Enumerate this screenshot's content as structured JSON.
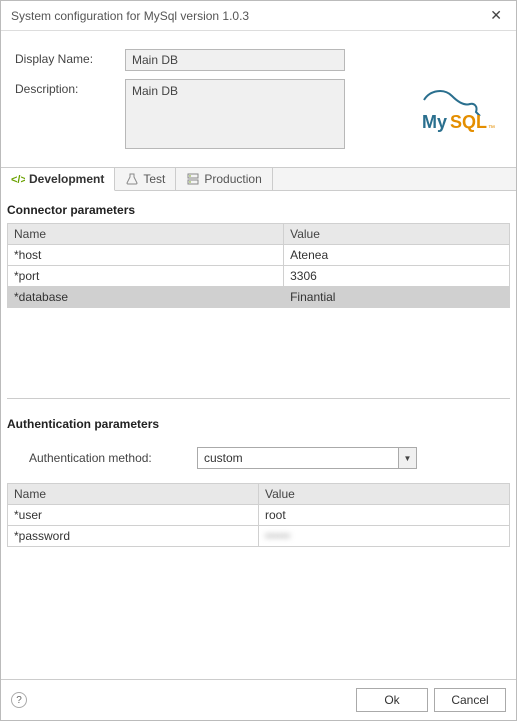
{
  "window": {
    "title": "System configuration for MySql version 1.0.3"
  },
  "header": {
    "display_name_label": "Display Name:",
    "display_name_value": "Main DB",
    "description_label": "Description:",
    "description_value": "Main DB",
    "logo_text_top": "My",
    "logo_text_bottom": "SQL"
  },
  "tabs": {
    "development": "Development",
    "test": "Test",
    "production": "Production"
  },
  "connector": {
    "title": "Connector parameters",
    "col_name": "Name",
    "col_value": "Value",
    "rows": [
      {
        "name": "*host",
        "value": "Atenea"
      },
      {
        "name": "*port",
        "value": "3306"
      },
      {
        "name": "*database",
        "value": "Finantial"
      }
    ]
  },
  "auth": {
    "title": "Authentication parameters",
    "method_label": "Authentication method:",
    "method_value": "custom",
    "col_name": "Name",
    "col_value": "Value",
    "rows": [
      {
        "name": "*user",
        "value": "root"
      },
      {
        "name": "*password",
        "value": "••••••"
      }
    ]
  },
  "footer": {
    "ok": "Ok",
    "cancel": "Cancel"
  }
}
